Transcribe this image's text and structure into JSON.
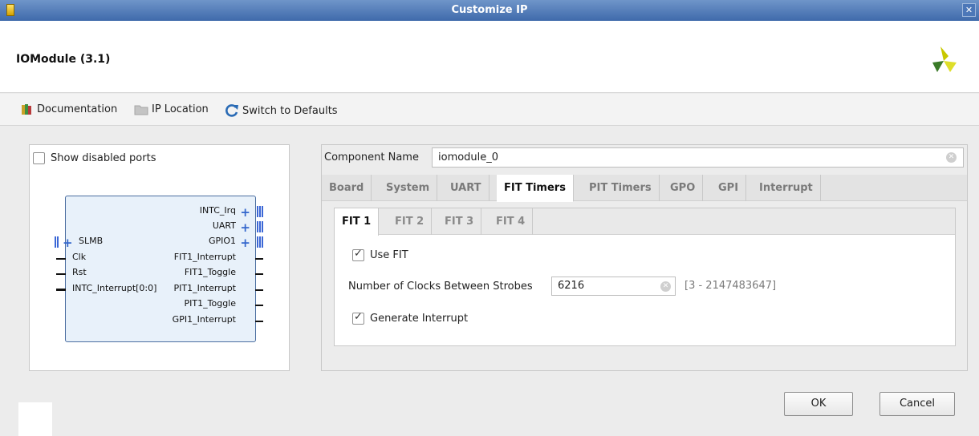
{
  "window": {
    "title": "Customize IP"
  },
  "header": {
    "title": "IOModule (3.1)"
  },
  "toolbar": {
    "documentation_label": "Documentation",
    "ip_location_label": "IP Location",
    "switch_defaults_label": "Switch to Defaults"
  },
  "symbol_panel": {
    "show_disabled_label": "Show disabled ports",
    "show_disabled_checked": false,
    "block": {
      "right_ports": [
        "INTC_Irq",
        "UART",
        "GPIO1",
        "FIT1_Interrupt",
        "FIT1_Toggle",
        "PIT1_Interrupt",
        "PIT1_Toggle",
        "GPI1_Interrupt"
      ],
      "left_ports": [
        "SLMB",
        "Clk",
        "Rst",
        "INTC_Interrupt[0:0]"
      ]
    }
  },
  "config_panel": {
    "component_name_label": "Component Name",
    "component_name_value": "iomodule_0",
    "tabs": [
      "Board",
      "System",
      "UART",
      "FIT Timers",
      "PIT Timers",
      "GPO",
      "GPI",
      "Interrupt"
    ],
    "active_tab": "FIT Timers",
    "subtabs": [
      "FIT 1",
      "FIT 2",
      "FIT 3",
      "FIT 4"
    ],
    "active_subtab": "FIT 1",
    "use_fit_label": "Use FIT",
    "use_fit_checked": true,
    "clocks_label": "Number of Clocks Between Strobes",
    "clocks_value": "6216",
    "clocks_range": "[3 - 2147483647]",
    "generate_interrupt_label": "Generate Interrupt",
    "generate_interrupt_checked": true
  },
  "buttons": {
    "ok": "OK",
    "cancel": "Cancel"
  },
  "colors": {
    "titlebar": "#4a74b4",
    "block_fill": "#e8f1fa",
    "bus_color": "#3b67d6",
    "logo_yellow": "#d2d000",
    "logo_green": "#3a7a28"
  }
}
